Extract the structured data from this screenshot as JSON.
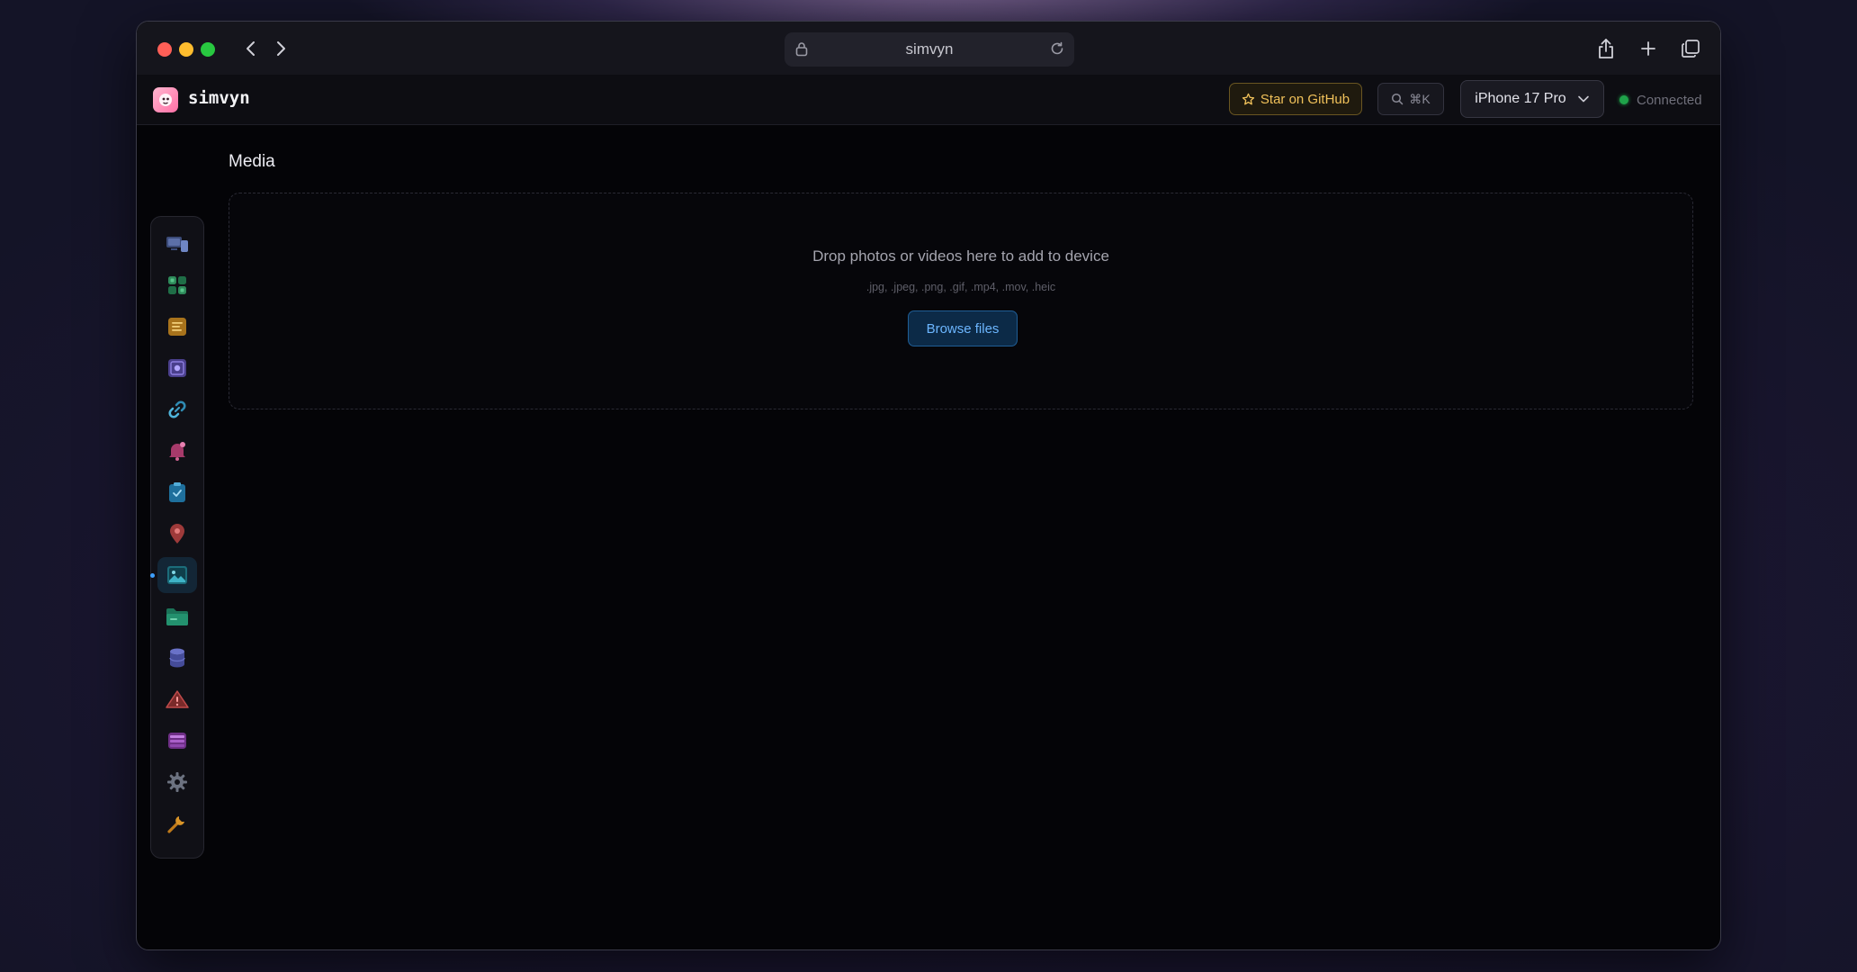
{
  "browser": {
    "url": "simvyn"
  },
  "app": {
    "name": "simvyn",
    "star_label": "Star on GitHub",
    "search_shortcut": "⌘K",
    "device": "iPhone 17 Pro",
    "status": "Connected",
    "status_color": "#1fa34a"
  },
  "sidebar": {
    "items": [
      {
        "icon": "devices-icon",
        "active": false
      },
      {
        "icon": "apps-grid-icon",
        "active": false
      },
      {
        "icon": "logs-icon",
        "active": false
      },
      {
        "icon": "screenshot-icon",
        "active": false
      },
      {
        "icon": "deep-link-icon",
        "active": false
      },
      {
        "icon": "notification-bell-icon",
        "active": false
      },
      {
        "icon": "clipboard-icon",
        "active": false
      },
      {
        "icon": "location-pin-icon",
        "active": false
      },
      {
        "icon": "media-image-icon",
        "active": true
      },
      {
        "icon": "folder-icon",
        "active": false
      },
      {
        "icon": "database-icon",
        "active": false
      },
      {
        "icon": "warning-icon",
        "active": false
      },
      {
        "icon": "layers-icon",
        "active": false
      },
      {
        "icon": "gear-icon",
        "active": false
      },
      {
        "icon": "wrench-icon",
        "active": false
      }
    ]
  },
  "main": {
    "title": "Media",
    "dropzone": {
      "message": "Drop photos or videos here to add to device",
      "formats": ".jpg, .jpeg, .png, .gif, .mp4, .mov, .heic",
      "button": "Browse files"
    }
  },
  "colors": {
    "accent": "#3ea0ff",
    "star_accent": "#f0c15a"
  }
}
